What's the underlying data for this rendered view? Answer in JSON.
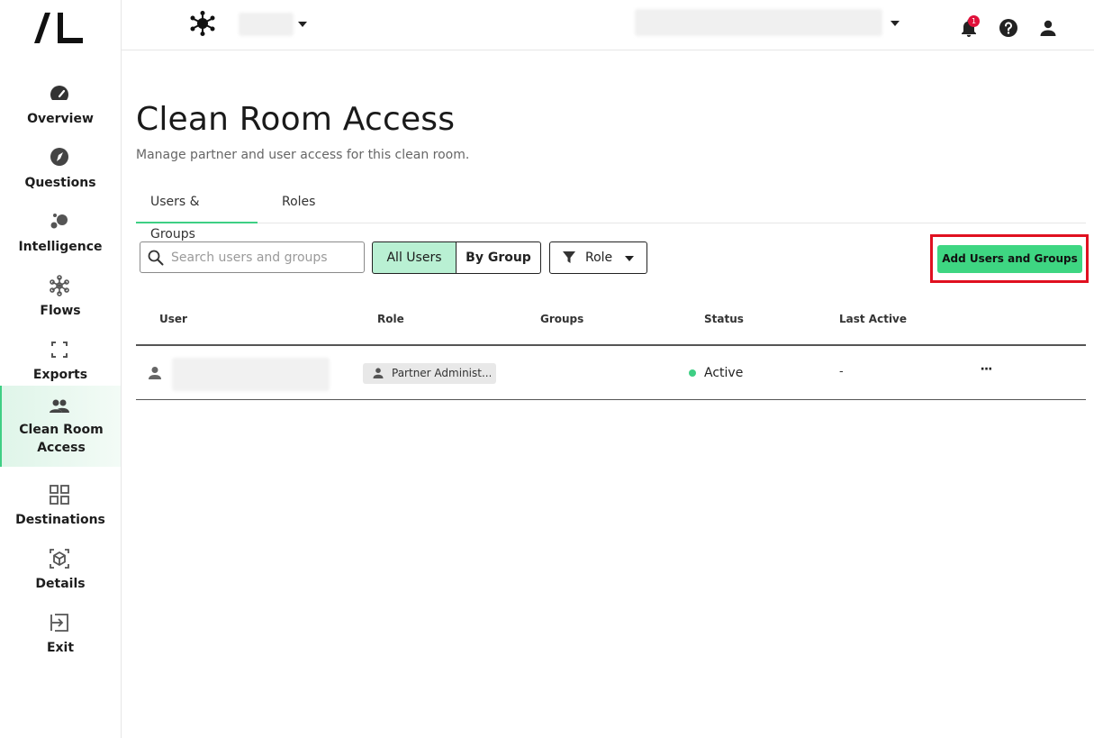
{
  "sidebar": {
    "logo": "/L",
    "items": [
      {
        "label": "Overview",
        "icon": "speedometer-icon"
      },
      {
        "label": "Questions",
        "icon": "compass-icon"
      },
      {
        "label": "Intelligence",
        "icon": "bubbles-icon"
      },
      {
        "label": "Flows",
        "icon": "network-icon"
      },
      {
        "label": "Exports",
        "icon": "frame-corners-icon"
      },
      {
        "label": "Clean Room Access",
        "icon": "people-icon",
        "active": true
      },
      {
        "label": "Destinations",
        "icon": "grid-icon"
      },
      {
        "label": "Details",
        "icon": "cube-icon"
      },
      {
        "label": "Exit",
        "icon": "exit-icon"
      }
    ]
  },
  "topbar": {
    "notification_count": "1"
  },
  "page": {
    "title": "Clean Room Access",
    "subtitle": "Manage partner and user access for this clean room."
  },
  "tabs": [
    {
      "label": "Users & Groups",
      "active": true
    },
    {
      "label": "Roles",
      "active": false
    }
  ],
  "toolbar": {
    "search_placeholder": "Search users and groups",
    "all_users_label": "All Users",
    "by_group_label": "By Group",
    "role_filter_label": "Role",
    "add_button_label": "Add Users and Groups"
  },
  "table": {
    "columns": [
      "User",
      "Role",
      "Groups",
      "Status",
      "Last Active"
    ],
    "rows": [
      {
        "user": "",
        "role": "Partner Administ...",
        "groups": "",
        "status": "Active",
        "last_active": "-"
      }
    ]
  },
  "colors": {
    "accent": "#3ecf84",
    "highlight_outline": "#e01020",
    "selected_segment": "#b9f0d3",
    "notification_badge": "#e0103a"
  }
}
